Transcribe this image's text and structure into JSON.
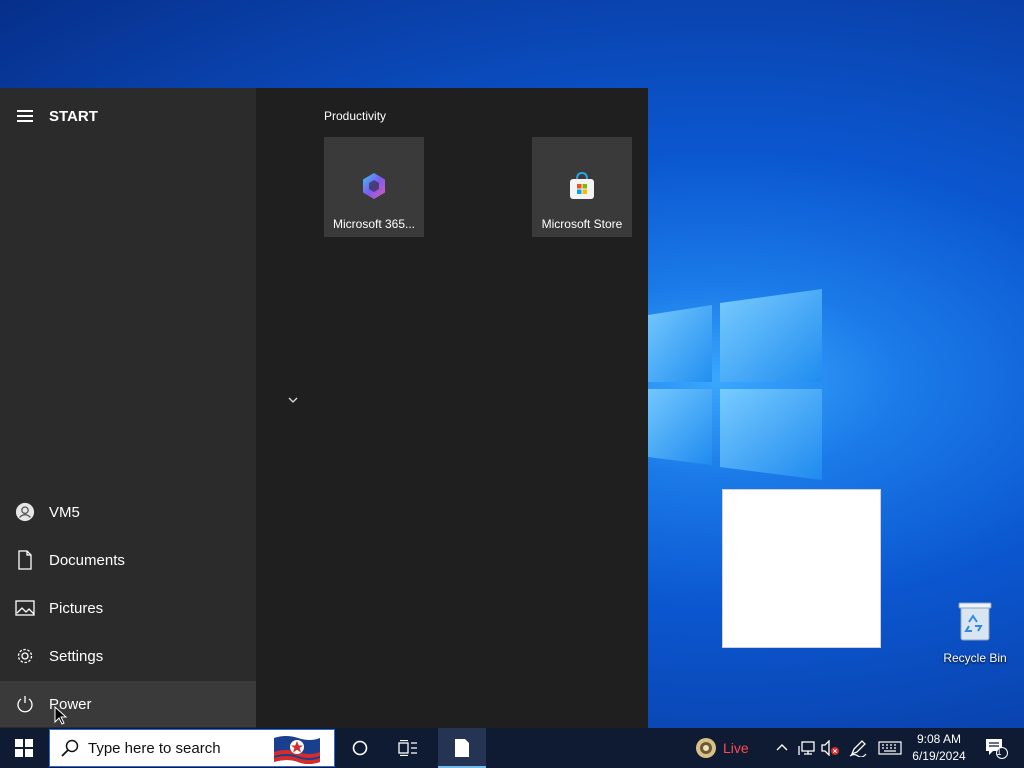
{
  "desktop": {
    "recycle_bin_label": "Recycle Bin"
  },
  "start_menu": {
    "header": "START",
    "nav": [
      {
        "label": "VM5",
        "icon": "user-icon"
      },
      {
        "label": "Documents",
        "icon": "document-icon"
      },
      {
        "label": "Pictures",
        "icon": "pictures-icon"
      },
      {
        "label": "Settings",
        "icon": "gear-icon"
      },
      {
        "label": "Power",
        "icon": "power-icon"
      }
    ],
    "group_title": "Productivity",
    "tiles": [
      {
        "label": "Microsoft 365...",
        "icon": "microsoft-365-icon"
      },
      {
        "label": "Microsoft Store",
        "icon": "microsoft-store-icon"
      }
    ]
  },
  "taskbar": {
    "search_placeholder": "Type here to search",
    "live_label": "Live",
    "time": "9:08 AM",
    "date": "6/19/2024",
    "notification_count": "1"
  },
  "colors": {
    "start_bg": "#1f1f1f",
    "start_left_bg": "#2b2b2b",
    "tile_bg": "#3a3a3a",
    "taskbar_bg": "#0f1a33",
    "live_red": "#ff4b4b"
  }
}
